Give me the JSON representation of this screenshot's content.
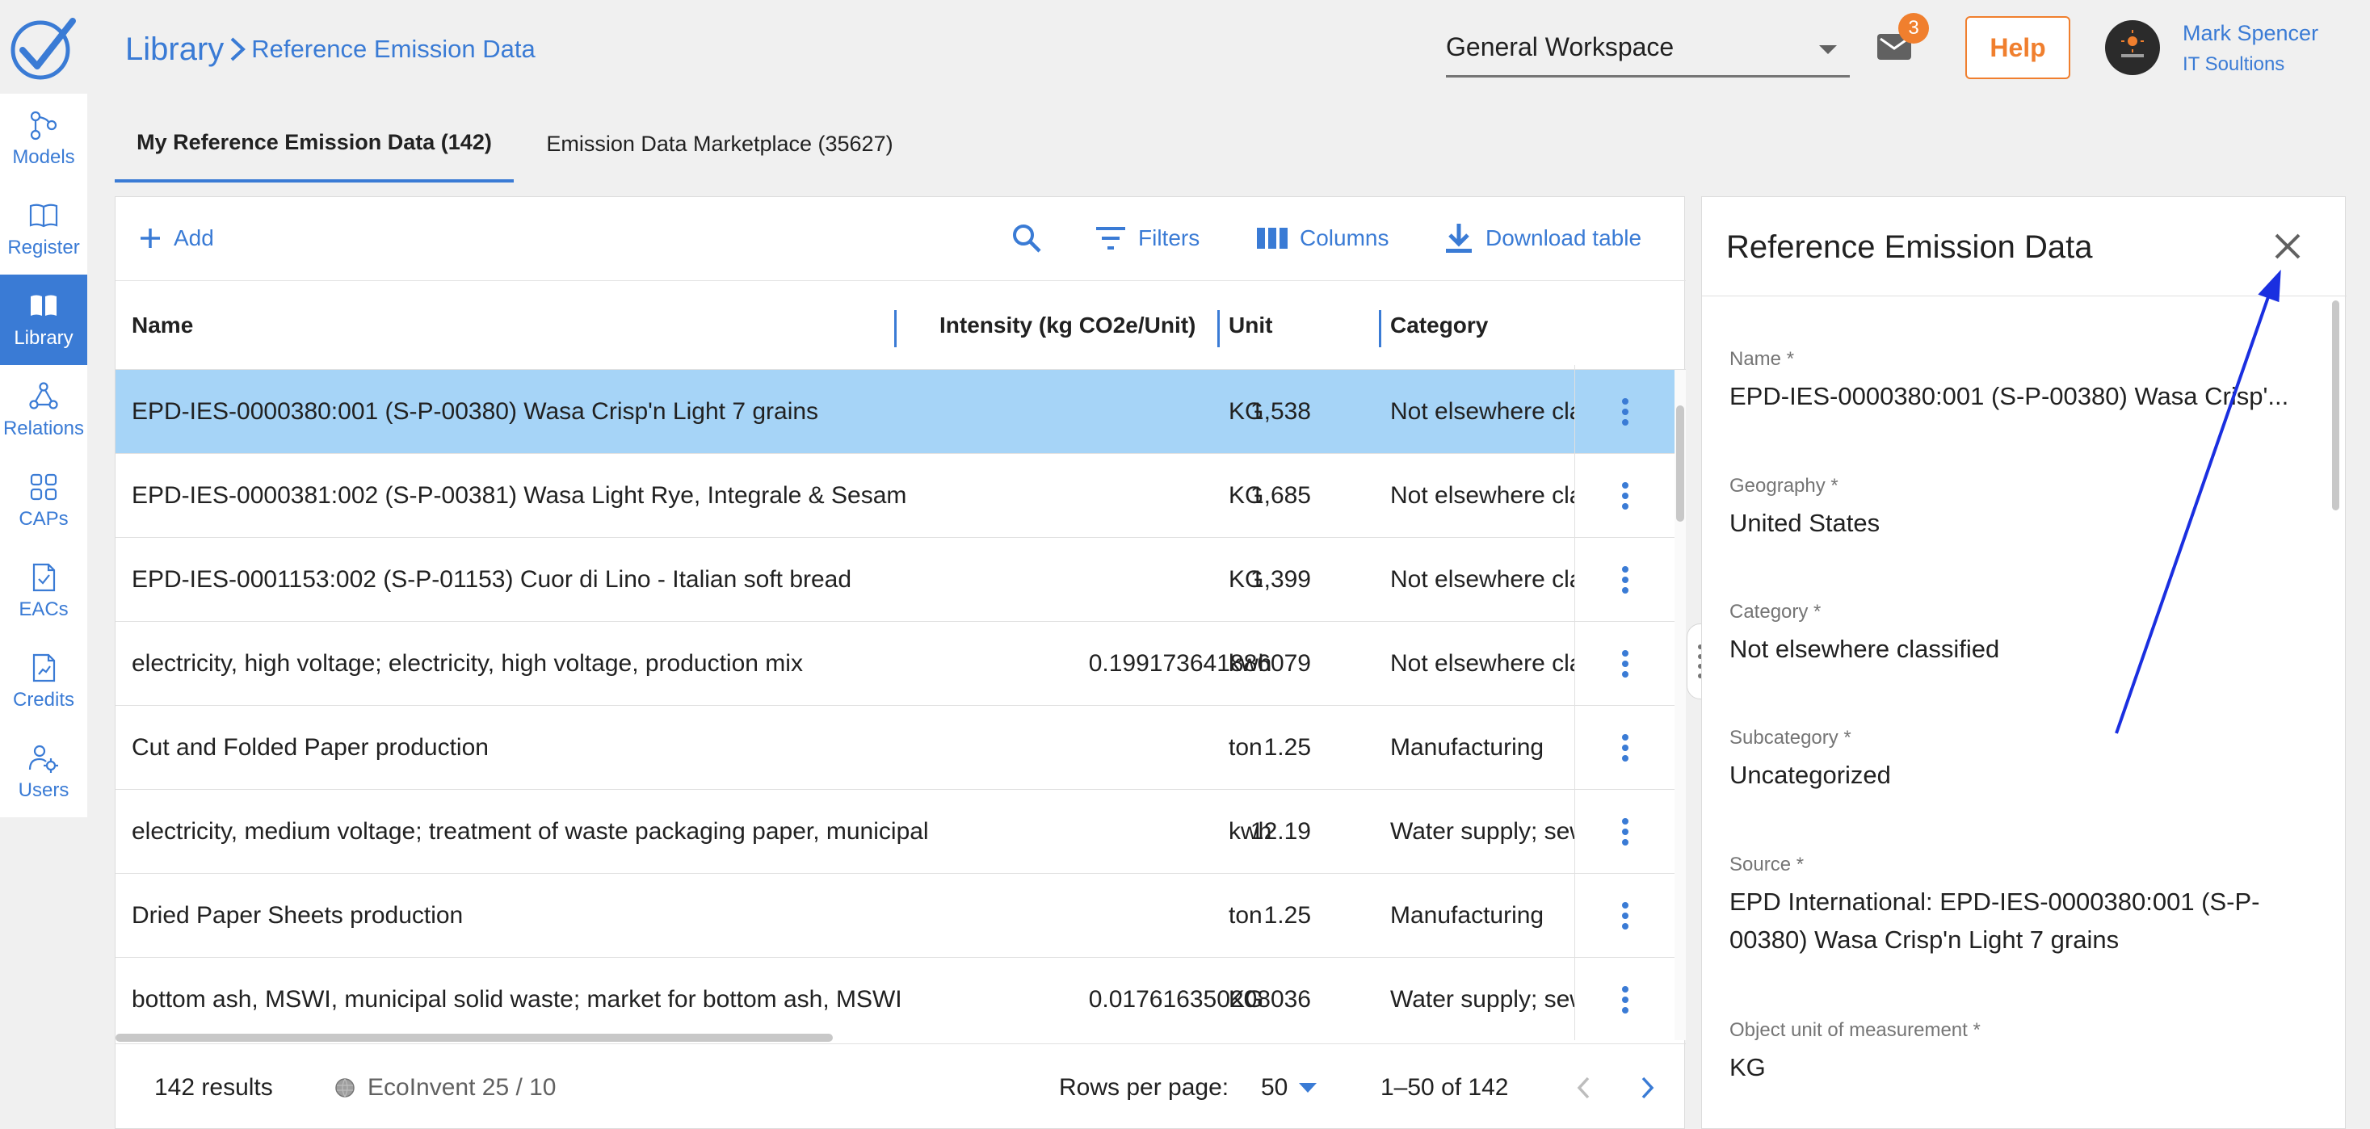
{
  "colors": {
    "accent": "#3a7bd5",
    "orange": "#f07f2e",
    "selected_row": "#a6d4f7",
    "annotation": "#1a2fe0"
  },
  "sidebar": {
    "logo": "checkmark-logo",
    "items": [
      {
        "label": "Models",
        "icon": "models-icon",
        "active": false
      },
      {
        "label": "Register",
        "icon": "register-book-icon",
        "active": false
      },
      {
        "label": "Library",
        "icon": "library-book-icon",
        "active": true
      },
      {
        "label": "Relations",
        "icon": "relations-icon",
        "active": false
      },
      {
        "label": "CAPs",
        "icon": "caps-grid-icon",
        "active": false
      },
      {
        "label": "EACs",
        "icon": "eacs-document-icon",
        "active": false
      },
      {
        "label": "Credits",
        "icon": "credits-document-icon",
        "active": false
      },
      {
        "label": "Users",
        "icon": "users-gear-icon",
        "active": false
      }
    ]
  },
  "header": {
    "breadcrumb_root": "Library",
    "breadcrumb_page": "Reference Emission Data",
    "workspace": "General Workspace",
    "mail_count": "3",
    "help_label": "Help",
    "user_name": "Mark Spencer",
    "user_org": "IT Soultions"
  },
  "tabs": [
    {
      "label": "My Reference Emission Data (142)",
      "active": true
    },
    {
      "label": "Emission Data Marketplace (35627)",
      "active": false
    }
  ],
  "toolbar": {
    "add_label": "Add",
    "filters_label": "Filters",
    "columns_label": "Columns",
    "download_label": "Download table"
  },
  "table": {
    "columns": [
      "Name",
      "Intensity (kg CO2e/Unit)",
      "Unit",
      "Category"
    ],
    "rows": [
      {
        "name": "EPD-IES-0000380:001 (S-P-00380) Wasa Crisp'n Light 7 grains",
        "intensity": "1,538",
        "unit": "KG",
        "category": "Not elsewhere classified",
        "selected": true
      },
      {
        "name": "EPD-IES-0000381:002 (S-P-00381) Wasa Light Rye, Integrale & Sesam",
        "intensity": "1,685",
        "unit": "KG",
        "category": "Not elsewhere classified",
        "selected": false
      },
      {
        "name": "EPD-IES-0001153:002 (S-P-01153) Cuor di Lino - Italian soft bread",
        "intensity": "1,399",
        "unit": "KG",
        "category": "Not elsewhere classified",
        "selected": false
      },
      {
        "name": "electricity, high voltage; electricity, high voltage, production mix",
        "intensity": "0.199173641886079",
        "unit": "kwh",
        "category": "Not elsewhere classified",
        "selected": false
      },
      {
        "name": "Cut and Folded Paper production",
        "intensity": "1.25",
        "unit": "ton",
        "category": "Manufacturing",
        "selected": false
      },
      {
        "name": "electricity, medium voltage; treatment of waste packaging paper, municipal",
        "intensity": "12.19",
        "unit": "kwh",
        "category": "Water supply; sewerage",
        "selected": false
      },
      {
        "name": "Dried Paper Sheets production",
        "intensity": "1.25",
        "unit": "ton",
        "category": "Manufacturing",
        "selected": false
      },
      {
        "name": "bottom ash, MSWI, municipal solid waste; market for bottom ash, MSWI",
        "intensity": "0.017616350208036",
        "unit": "KG",
        "category": "Water supply; sewerage",
        "selected": false
      }
    ]
  },
  "footer": {
    "results": "142 results",
    "ecoinvent": "EcoInvent 25 / 10",
    "rows_per_page_label": "Rows per page:",
    "rows_per_page_value": "50",
    "range": "1–50 of 142"
  },
  "detail": {
    "title": "Reference Emission Data",
    "fields": [
      {
        "label": "Name *",
        "value": "EPD-IES-0000380:001 (S-P-00380) Wasa Crisp'..."
      },
      {
        "label": "Geography *",
        "value": "United States"
      },
      {
        "label": "Category *",
        "value": "Not elsewhere classified"
      },
      {
        "label": "Subcategory *",
        "value": "Uncategorized"
      },
      {
        "label": "Source *",
        "value": "EPD International: EPD-IES-0000380:001 (S-P-00380) Wasa Crisp'n Light 7 grains"
      },
      {
        "label": "Object unit of measurement *",
        "value": "KG"
      }
    ]
  }
}
